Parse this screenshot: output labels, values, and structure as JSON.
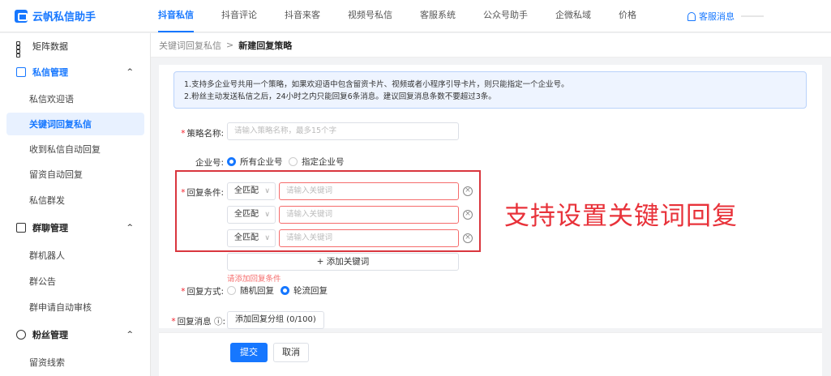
{
  "app": {
    "title": "云帆私信助手"
  },
  "topnav": {
    "items": [
      "抖音私信",
      "抖音评论",
      "抖音来客",
      "视频号私信",
      "客服系统",
      "公众号助手",
      "企微私域",
      "价格"
    ],
    "active": "抖音私信",
    "message_label": "客服消息"
  },
  "sidebar": {
    "matrix": "矩阵数据",
    "groups": [
      {
        "label": "私信管理",
        "icon": "chat-icon",
        "items": [
          "私信欢迎语",
          "关键词回复私信",
          "收到私信自动回复",
          "留资自动回复",
          "私信群发"
        ]
      },
      {
        "label": "群聊管理",
        "icon": "group-chat-icon",
        "items": [
          "群机器人",
          "群公告",
          "群申请自动审核"
        ]
      },
      {
        "label": "粉丝管理",
        "icon": "fans-icon",
        "items": [
          "留资线索"
        ]
      }
    ],
    "active_item": "关键词回复私信"
  },
  "breadcrumb": {
    "parent": "关键词回复私信",
    "separator": ">",
    "current": "新建回复策略"
  },
  "notice": {
    "line1": "1.支持多企业号共用一个策略，如果欢迎语中包含留资卡片、视频或者小程序引导卡片，则只能指定一个企业号。",
    "line2": "2.粉丝主动发送私信之后，24小时之内只能回复6条消息。建议回复消息条数不要超过3条。"
  },
  "form": {
    "name_label": "策略名称:",
    "name_placeholder": "请输入策略名称，最多15个字",
    "account_label": "企业号:",
    "account_options": [
      "所有企业号",
      "指定企业号"
    ],
    "account_selected": "所有企业号",
    "condition_label": "回复条件:",
    "conditions": [
      {
        "match": "全匹配",
        "placeholder": "请输入关键词"
      },
      {
        "match": "全匹配",
        "placeholder": "请输入关键词"
      },
      {
        "match": "全匹配",
        "placeholder": "请输入关键词"
      }
    ],
    "add_keyword": "+  添加关键词",
    "condition_error": "请添加回复条件",
    "mode_label": "回复方式:",
    "mode_options": [
      "随机回复",
      "轮流回复"
    ],
    "mode_selected": "轮流回复",
    "message_label": "回复消息 ⓘ:",
    "add_group": "添加回复分组 (0/100)"
  },
  "annotation": "支持设置关键词回复",
  "footer": {
    "submit": "提交",
    "cancel": "取消"
  },
  "colors": {
    "accent": "#1677ff",
    "error": "#f56c6c",
    "annotation": "#e8323a"
  }
}
